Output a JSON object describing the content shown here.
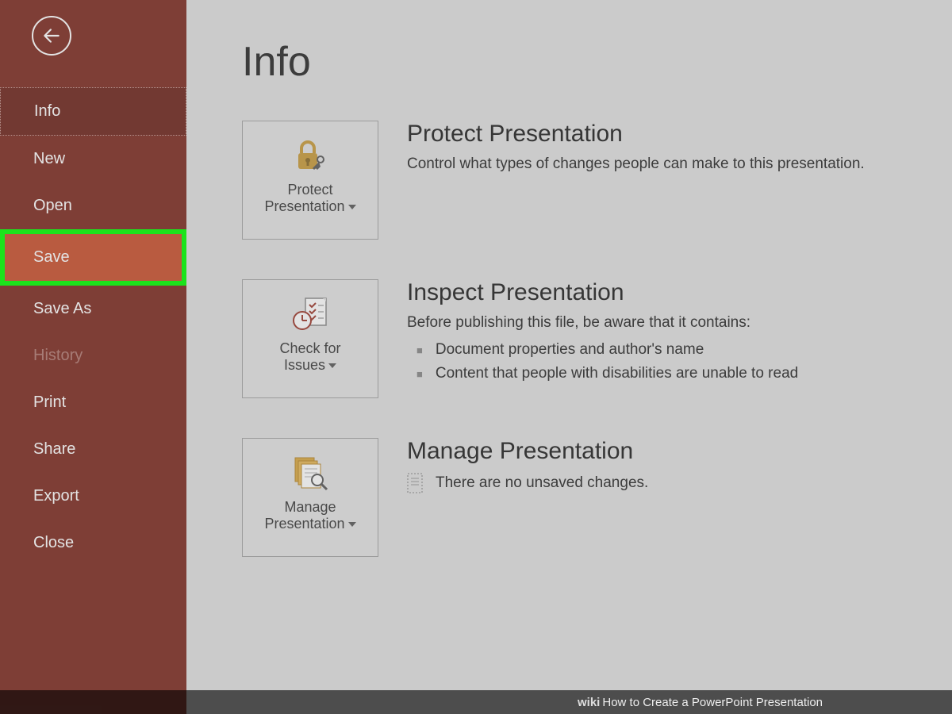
{
  "sidebar": {
    "items": [
      {
        "label": "Info",
        "state": "selected"
      },
      {
        "label": "New",
        "state": ""
      },
      {
        "label": "Open",
        "state": ""
      },
      {
        "label": "Save",
        "state": "highlighted"
      },
      {
        "label": "Save As",
        "state": ""
      },
      {
        "label": "History",
        "state": "disabled"
      },
      {
        "label": "Print",
        "state": ""
      },
      {
        "label": "Share",
        "state": ""
      },
      {
        "label": "Export",
        "state": ""
      },
      {
        "label": "Close",
        "state": ""
      }
    ]
  },
  "main": {
    "title": "Info",
    "sections": {
      "protect": {
        "tile_label1": "Protect",
        "tile_label2": "Presentation",
        "heading": "Protect Presentation",
        "desc": "Control what types of changes people can make to this presentation."
      },
      "inspect": {
        "tile_label1": "Check for",
        "tile_label2": "Issues",
        "heading": "Inspect Presentation",
        "desc": "Before publishing this file, be aware that it contains:",
        "bullets": [
          "Document properties and author's name",
          "Content that people with disabilities are unable to read"
        ]
      },
      "manage": {
        "tile_label1": "Manage",
        "tile_label2": "Presentation",
        "heading": "Manage Presentation",
        "desc": "There are no unsaved changes."
      }
    }
  },
  "footer": {
    "prefix": "wiki",
    "text": "How to Create a PowerPoint Presentation"
  }
}
